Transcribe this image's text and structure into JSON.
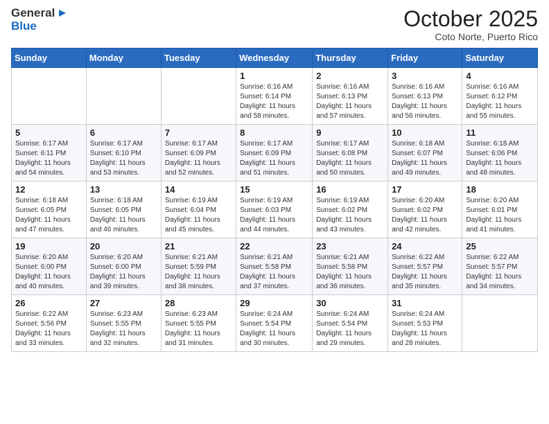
{
  "logo": {
    "text_general": "General",
    "text_blue": "Blue"
  },
  "header": {
    "month": "October 2025",
    "location": "Coto Norte, Puerto Rico"
  },
  "weekdays": [
    "Sunday",
    "Monday",
    "Tuesday",
    "Wednesday",
    "Thursday",
    "Friday",
    "Saturday"
  ],
  "weeks": [
    [
      {
        "day": "",
        "sunrise": "",
        "sunset": "",
        "daylight": ""
      },
      {
        "day": "",
        "sunrise": "",
        "sunset": "",
        "daylight": ""
      },
      {
        "day": "",
        "sunrise": "",
        "sunset": "",
        "daylight": ""
      },
      {
        "day": "1",
        "sunrise": "Sunrise: 6:16 AM",
        "sunset": "Sunset: 6:14 PM",
        "daylight": "Daylight: 11 hours and 58 minutes."
      },
      {
        "day": "2",
        "sunrise": "Sunrise: 6:16 AM",
        "sunset": "Sunset: 6:13 PM",
        "daylight": "Daylight: 11 hours and 57 minutes."
      },
      {
        "day": "3",
        "sunrise": "Sunrise: 6:16 AM",
        "sunset": "Sunset: 6:13 PM",
        "daylight": "Daylight: 11 hours and 56 minutes."
      },
      {
        "day": "4",
        "sunrise": "Sunrise: 6:16 AM",
        "sunset": "Sunset: 6:12 PM",
        "daylight": "Daylight: 11 hours and 55 minutes."
      }
    ],
    [
      {
        "day": "5",
        "sunrise": "Sunrise: 6:17 AM",
        "sunset": "Sunset: 6:11 PM",
        "daylight": "Daylight: 11 hours and 54 minutes."
      },
      {
        "day": "6",
        "sunrise": "Sunrise: 6:17 AM",
        "sunset": "Sunset: 6:10 PM",
        "daylight": "Daylight: 11 hours and 53 minutes."
      },
      {
        "day": "7",
        "sunrise": "Sunrise: 6:17 AM",
        "sunset": "Sunset: 6:09 PM",
        "daylight": "Daylight: 11 hours and 52 minutes."
      },
      {
        "day": "8",
        "sunrise": "Sunrise: 6:17 AM",
        "sunset": "Sunset: 6:09 PM",
        "daylight": "Daylight: 11 hours and 51 minutes."
      },
      {
        "day": "9",
        "sunrise": "Sunrise: 6:17 AM",
        "sunset": "Sunset: 6:08 PM",
        "daylight": "Daylight: 11 hours and 50 minutes."
      },
      {
        "day": "10",
        "sunrise": "Sunrise: 6:18 AM",
        "sunset": "Sunset: 6:07 PM",
        "daylight": "Daylight: 11 hours and 49 minutes."
      },
      {
        "day": "11",
        "sunrise": "Sunrise: 6:18 AM",
        "sunset": "Sunset: 6:06 PM",
        "daylight": "Daylight: 11 hours and 48 minutes."
      }
    ],
    [
      {
        "day": "12",
        "sunrise": "Sunrise: 6:18 AM",
        "sunset": "Sunset: 6:05 PM",
        "daylight": "Daylight: 11 hours and 47 minutes."
      },
      {
        "day": "13",
        "sunrise": "Sunrise: 6:18 AM",
        "sunset": "Sunset: 6:05 PM",
        "daylight": "Daylight: 11 hours and 46 minutes."
      },
      {
        "day": "14",
        "sunrise": "Sunrise: 6:19 AM",
        "sunset": "Sunset: 6:04 PM",
        "daylight": "Daylight: 11 hours and 45 minutes."
      },
      {
        "day": "15",
        "sunrise": "Sunrise: 6:19 AM",
        "sunset": "Sunset: 6:03 PM",
        "daylight": "Daylight: 11 hours and 44 minutes."
      },
      {
        "day": "16",
        "sunrise": "Sunrise: 6:19 AM",
        "sunset": "Sunset: 6:02 PM",
        "daylight": "Daylight: 11 hours and 43 minutes."
      },
      {
        "day": "17",
        "sunrise": "Sunrise: 6:20 AM",
        "sunset": "Sunset: 6:02 PM",
        "daylight": "Daylight: 11 hours and 42 minutes."
      },
      {
        "day": "18",
        "sunrise": "Sunrise: 6:20 AM",
        "sunset": "Sunset: 6:01 PM",
        "daylight": "Daylight: 11 hours and 41 minutes."
      }
    ],
    [
      {
        "day": "19",
        "sunrise": "Sunrise: 6:20 AM",
        "sunset": "Sunset: 6:00 PM",
        "daylight": "Daylight: 11 hours and 40 minutes."
      },
      {
        "day": "20",
        "sunrise": "Sunrise: 6:20 AM",
        "sunset": "Sunset: 6:00 PM",
        "daylight": "Daylight: 11 hours and 39 minutes."
      },
      {
        "day": "21",
        "sunrise": "Sunrise: 6:21 AM",
        "sunset": "Sunset: 5:59 PM",
        "daylight": "Daylight: 11 hours and 38 minutes."
      },
      {
        "day": "22",
        "sunrise": "Sunrise: 6:21 AM",
        "sunset": "Sunset: 5:58 PM",
        "daylight": "Daylight: 11 hours and 37 minutes."
      },
      {
        "day": "23",
        "sunrise": "Sunrise: 6:21 AM",
        "sunset": "Sunset: 5:58 PM",
        "daylight": "Daylight: 11 hours and 36 minutes."
      },
      {
        "day": "24",
        "sunrise": "Sunrise: 6:22 AM",
        "sunset": "Sunset: 5:57 PM",
        "daylight": "Daylight: 11 hours and 35 minutes."
      },
      {
        "day": "25",
        "sunrise": "Sunrise: 6:22 AM",
        "sunset": "Sunset: 5:57 PM",
        "daylight": "Daylight: 11 hours and 34 minutes."
      }
    ],
    [
      {
        "day": "26",
        "sunrise": "Sunrise: 6:22 AM",
        "sunset": "Sunset: 5:56 PM",
        "daylight": "Daylight: 11 hours and 33 minutes."
      },
      {
        "day": "27",
        "sunrise": "Sunrise: 6:23 AM",
        "sunset": "Sunset: 5:55 PM",
        "daylight": "Daylight: 11 hours and 32 minutes."
      },
      {
        "day": "28",
        "sunrise": "Sunrise: 6:23 AM",
        "sunset": "Sunset: 5:55 PM",
        "daylight": "Daylight: 11 hours and 31 minutes."
      },
      {
        "day": "29",
        "sunrise": "Sunrise: 6:24 AM",
        "sunset": "Sunset: 5:54 PM",
        "daylight": "Daylight: 11 hours and 30 minutes."
      },
      {
        "day": "30",
        "sunrise": "Sunrise: 6:24 AM",
        "sunset": "Sunset: 5:54 PM",
        "daylight": "Daylight: 11 hours and 29 minutes."
      },
      {
        "day": "31",
        "sunrise": "Sunrise: 6:24 AM",
        "sunset": "Sunset: 5:53 PM",
        "daylight": "Daylight: 11 hours and 28 minutes."
      },
      {
        "day": "",
        "sunrise": "",
        "sunset": "",
        "daylight": ""
      }
    ]
  ]
}
